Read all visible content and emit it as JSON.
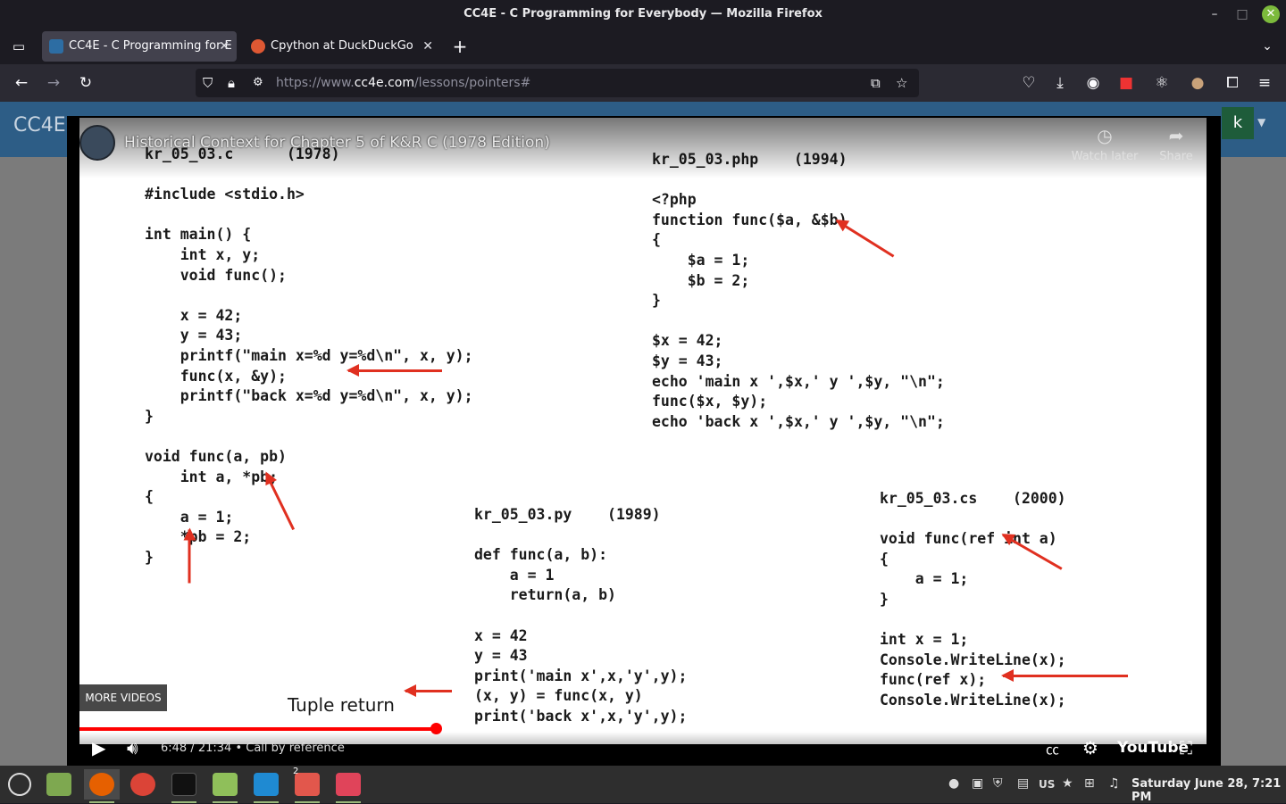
{
  "window": {
    "title": "CC4E - C Programming for Everybody — Mozilla Firefox"
  },
  "tabs": [
    {
      "label": "CC4E - C Programming for E",
      "active": true,
      "favicon_color": "#2d6da3"
    },
    {
      "label": "Cpython at DuckDuckGo",
      "active": false,
      "favicon_color": "#de5833"
    }
  ],
  "url": {
    "prefix": "https://www.",
    "host": "cc4e.com",
    "path": "/lessons/pointers#"
  },
  "site": {
    "logo": "CC4E",
    "user_initial": "k"
  },
  "video": {
    "title": "Historical Context for Chapter 5 of K&R C (1978 Edition)",
    "watch_later": "Watch later",
    "share": "Share",
    "more_videos": "MORE VIDEOS",
    "time": "6:48 / 21:34",
    "separator": "•",
    "chapter": "Call by reference",
    "progress": 0.316,
    "youtube": "YouTube"
  },
  "slide": {
    "c_code": "kr_05_03.c      (1978)\n\n#include <stdio.h>\n\nint main() {\n    int x, y;\n    void func();\n\n    x = 42;\n    y = 43;\n    printf(\"main x=%d y=%d\\n\", x, y);\n    func(x, &y);\n    printf(\"back x=%d y=%d\\n\", x, y);\n}\n\nvoid func(a, pb)\n    int a, *pb;\n{\n    a = 1;\n    *pb = 2;\n}",
    "php_code": "kr_05_03.php    (1994)\n\n<?php\nfunction func($a, &$b)\n{\n    $a = 1;\n    $b = 2;\n}\n\n$x = 42;\n$y = 43;\necho 'main x ',$x,' y ',$y, \"\\n\";\nfunc($x, $y);\necho 'back x ',$x,' y ',$y, \"\\n\";",
    "py_code": "kr_05_03.py    (1989)\n\ndef func(a, b):\n    a = 1\n    return(a, b)\n\nx = 42\ny = 43\nprint('main x',x,'y',y);\n(x, y) = func(x, y)\nprint('back x',x,'y',y);",
    "cs_code": "kr_05_03.cs    (2000)\n\nvoid func(ref int a)\n{\n    a = 1;\n}\n\nint x = 1;\nConsole.WriteLine(x);\nfunc(ref x);\nConsole.WriteLine(x);",
    "tuple_label": "Tuple return"
  },
  "taskbar": {
    "clock": "Saturday June 28, 7:21 PM",
    "keyboard": "US",
    "badge": "2"
  }
}
